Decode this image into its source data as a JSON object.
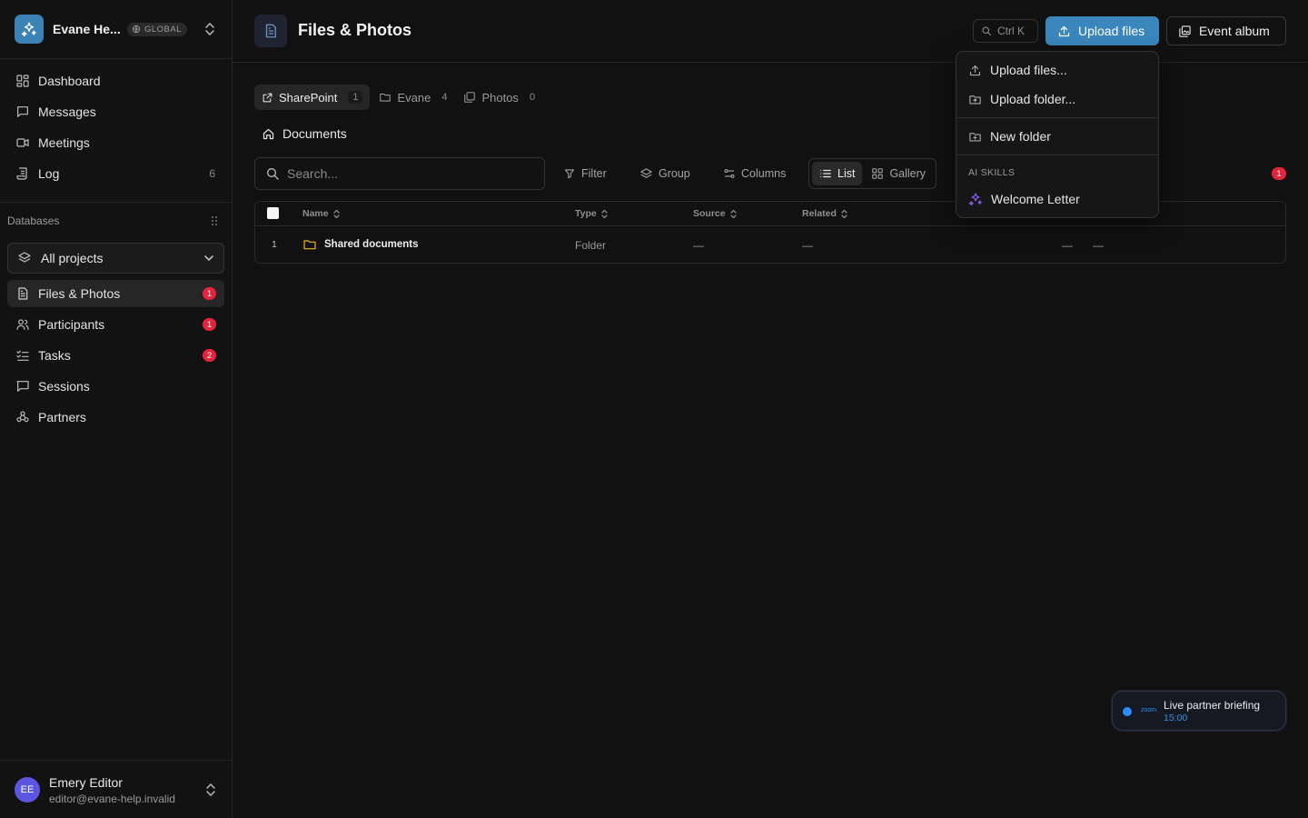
{
  "workspace": {
    "name": "Evane He...",
    "badge": "GLOBAL"
  },
  "sidebar": {
    "nav": [
      {
        "label": "Dashboard"
      },
      {
        "label": "Messages"
      },
      {
        "label": "Meetings"
      },
      {
        "label": "Log",
        "count": "6"
      }
    ],
    "databases_label": "Databases",
    "project_select": "All projects",
    "db_items": [
      {
        "label": "Files & Photos",
        "badge": "1"
      },
      {
        "label": "Participants",
        "badge": "1"
      },
      {
        "label": "Tasks",
        "badge": "2"
      },
      {
        "label": "Sessions"
      },
      {
        "label": "Partners"
      }
    ]
  },
  "user": {
    "initials": "EE",
    "name": "Emery Editor",
    "email": "editor@evane-help.invalid"
  },
  "header": {
    "title": "Files & Photos",
    "shortcut": "Ctrl K",
    "upload_button": "Upload files",
    "album_button": "Event album"
  },
  "tabs": [
    {
      "label": "SharePoint",
      "count": "1"
    },
    {
      "label": "Evane",
      "count": "4"
    },
    {
      "label": "Photos",
      "count": "0"
    }
  ],
  "breadcrumb": "Documents",
  "toolbar": {
    "search_placeholder": "Search...",
    "filter": "Filter",
    "group": "Group",
    "columns": "Columns",
    "list": "List",
    "gallery": "Gallery",
    "badge": "1"
  },
  "table": {
    "columns": [
      "Name",
      "Type",
      "Source",
      "Related"
    ],
    "rows": [
      {
        "index": "1",
        "name": "Shared documents",
        "type": "Folder",
        "source": "—",
        "related": "—",
        "extra1": "—",
        "extra2": "—"
      }
    ]
  },
  "upload_menu": {
    "items": [
      "Upload files...",
      "Upload folder...",
      "New folder"
    ],
    "section_label": "AI SKILLS",
    "skill": "Welcome Letter"
  },
  "live_event": {
    "provider": "zoom",
    "title": "Live partner briefing",
    "time": "15:00"
  },
  "colors": {
    "accent": "#3a86bd",
    "badge": "#e5243b",
    "avatar": "#5b55e0",
    "skill_icon": "#8b5cf6"
  }
}
